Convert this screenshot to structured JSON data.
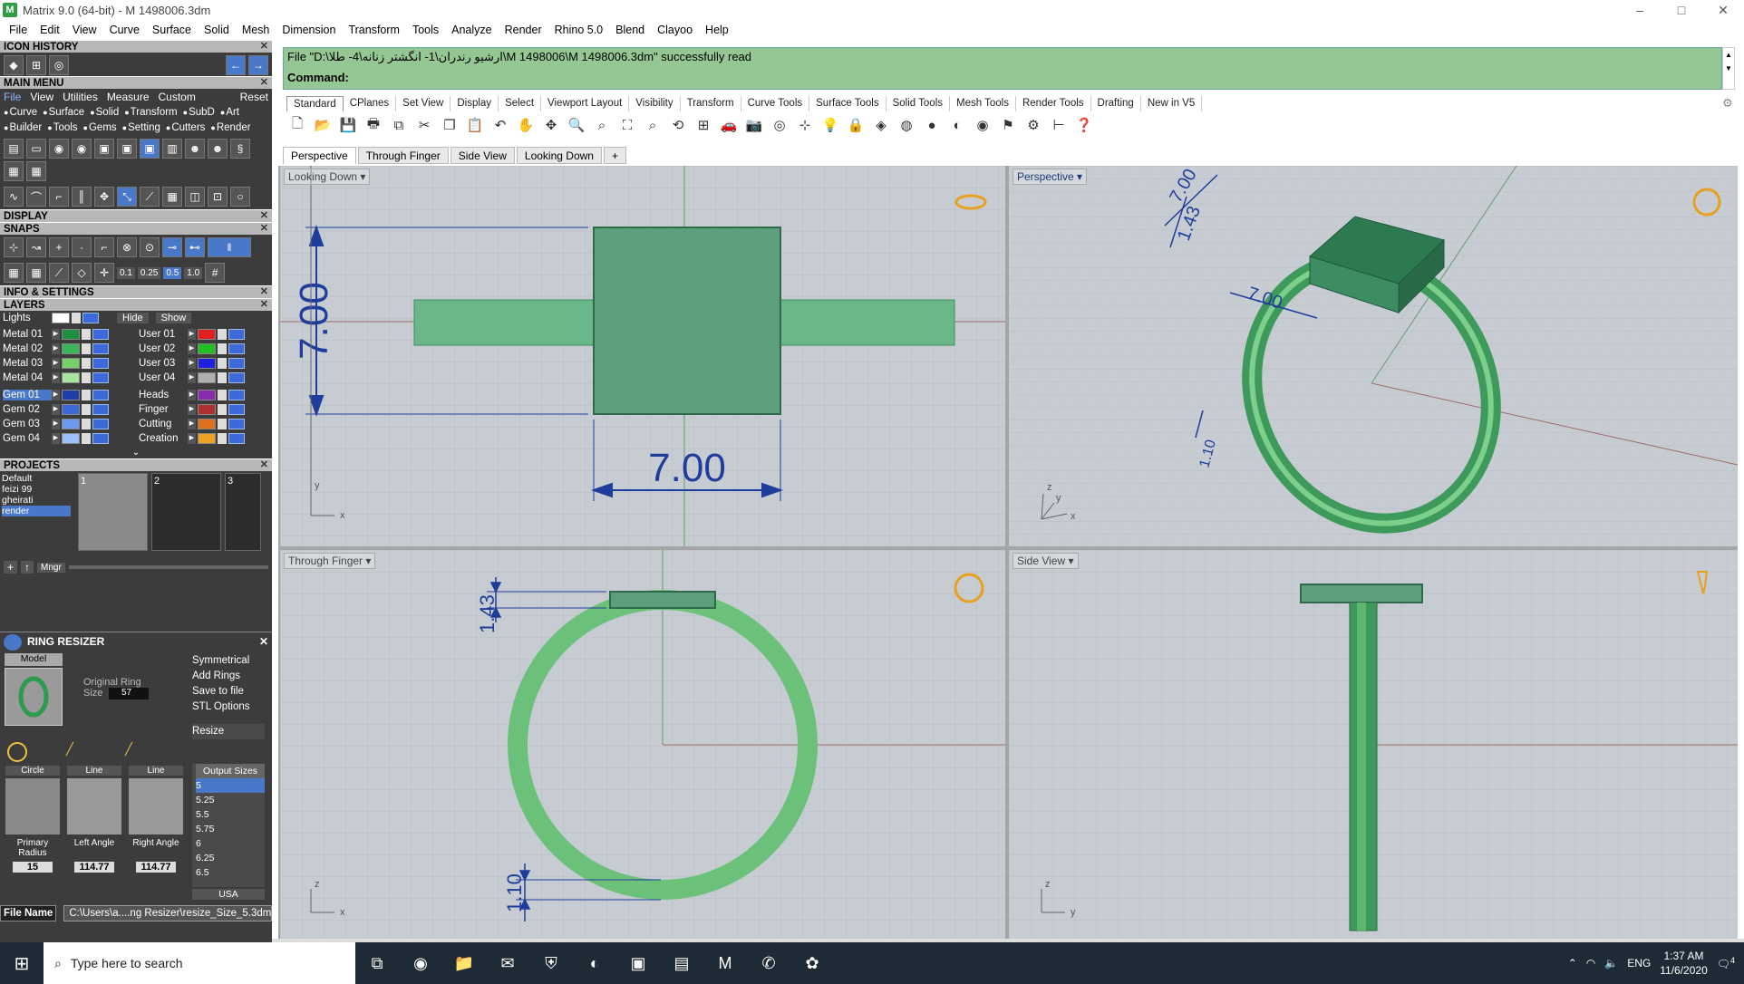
{
  "window": {
    "title": "Matrix 9.0 (64-bit) - M 1498006.3dm",
    "app_icon": "M",
    "controls": [
      "–",
      "□",
      "✕"
    ]
  },
  "menu": [
    "File",
    "Edit",
    "View",
    "Curve",
    "Surface",
    "Solid",
    "Mesh",
    "Dimension",
    "Transform",
    "Tools",
    "Analyze",
    "Render",
    "Rhino 5.0",
    "Blend",
    "Clayoo",
    "Help"
  ],
  "left_panel": {
    "icon_history": "ICON HISTORY",
    "main_menu": "MAIN MENU",
    "main_menu_tabs": [
      "File",
      "View",
      "Utilities",
      "Measure",
      "Custom"
    ],
    "reset": "Reset",
    "categories": [
      "Curve",
      "Surface",
      "Solid",
      "Transform",
      "SubD",
      "Art",
      "Builder",
      "Tools",
      "Gems",
      "Setting",
      "Cutters",
      "Render"
    ],
    "display": "DISPLAY",
    "snaps": "SNAPS",
    "snap_values": [
      "0.1",
      "0.25",
      "0.5",
      "1.0"
    ],
    "info_settings": "INFO & SETTINGS",
    "layers_title": "LAYERS",
    "lights": "Lights",
    "hide": "Hide",
    "show": "Show",
    "layers_left": [
      {
        "name": "Metal 01",
        "color": "#1e8f3e"
      },
      {
        "name": "Metal 02",
        "color": "#3cb45a"
      },
      {
        "name": "Metal 03",
        "color": "#78d06a"
      },
      {
        "name": "Metal 04",
        "color": "#a8e6a0"
      },
      {
        "name": "Gem 01",
        "color": "#1e3fa8"
      },
      {
        "name": "Gem 02",
        "color": "#3c6ad8"
      },
      {
        "name": "Gem 03",
        "color": "#6a9aee"
      },
      {
        "name": "Gem 04",
        "color": "#9cc0f8"
      }
    ],
    "layers_right": [
      {
        "name": "User 01",
        "color": "#e02020"
      },
      {
        "name": "User 02",
        "color": "#20c020"
      },
      {
        "name": "User 03",
        "color": "#2020e0"
      },
      {
        "name": "User 04",
        "color": "#b0b0b0"
      },
      {
        "name": "Heads",
        "color": "#8a2ab0"
      },
      {
        "name": "Finger",
        "color": "#b03030"
      },
      {
        "name": "Cutting",
        "color": "#e07020"
      },
      {
        "name": "Creation",
        "color": "#f0a020"
      }
    ],
    "projects_title": "PROJECTS",
    "projects": [
      "Default",
      "feizi 99",
      "gheirati",
      "render"
    ],
    "project_slots": [
      "1",
      "2",
      "3"
    ],
    "mngr": "Mngr",
    "ring_resizer": {
      "title": "RING  RESIZER",
      "model": "Model",
      "original_ring_label": "Original Ring",
      "size_label": "Size",
      "size_value": "57",
      "options": [
        "Symmetrical",
        "Add Rings",
        "Save to file",
        "STL Options"
      ],
      "resize": "Resize",
      "tool_labels": [
        "Circle",
        "Line",
        "Line"
      ],
      "output_sizes_title": "Output Sizes",
      "output_sizes": [
        "5",
        "5.25",
        "5.5",
        "5.75",
        "6",
        "6.25",
        "6.5"
      ],
      "output_unit": "USA",
      "primary_radius_label": "Primary Radius",
      "primary_radius": "15",
      "left_angle_label": "Left Angle",
      "left_angle": "114.77",
      "right_angle_label": "Right Angle",
      "right_angle": "114.77"
    },
    "file_name_label": "File Name",
    "file_name_value": "C:\\Users\\a....ng Resizer\\resize_Size_5.3dm"
  },
  "command": {
    "message": "File \"D:\\ارشیو رندران\\1- انگشتر زنانه\\4- طلا\\M 1498006\\M 1498006.3dm\" successfully read",
    "prompt": "Command:"
  },
  "tool_tabs": [
    "Standard",
    "CPlanes",
    "Set View",
    "Display",
    "Select",
    "Viewport Layout",
    "Visibility",
    "Transform",
    "Curve Tools",
    "Surface Tools",
    "Solid Tools",
    "Mesh Tools",
    "Render Tools",
    "Drafting",
    "New in V5"
  ],
  "viewport_tabs": [
    "Perspective",
    "Through Finger",
    "Side View",
    "Looking Down"
  ],
  "viewports": {
    "top_left": "Looking Down",
    "top_right": "Perspective",
    "bottom_left": "Through Finger",
    "bottom_right": "Side View"
  },
  "dimensions": {
    "looking_down_vertical": "7.00",
    "looking_down_horizontal": "7.00",
    "perspective_a": "7.00",
    "perspective_b": "1.43",
    "perspective_c": "7.00",
    "perspective_d": "1.10",
    "through_finger_top": "1.43",
    "through_finger_bottom": "1.10"
  },
  "axes": {
    "x": "x",
    "y": "y",
    "z": "z"
  },
  "taskbar": {
    "search_placeholder": "Type here to search",
    "lang": "ENG",
    "time": "1:37 AM",
    "date": "11/6/2020",
    "notifications": "4"
  },
  "colors": {
    "command_bg": "#95c794",
    "ring_green": "#6cc17a",
    "head_green": "#5a9e7a",
    "dim_blue": "#1f3d9a",
    "viewport_bg": "#c7ccd3"
  }
}
